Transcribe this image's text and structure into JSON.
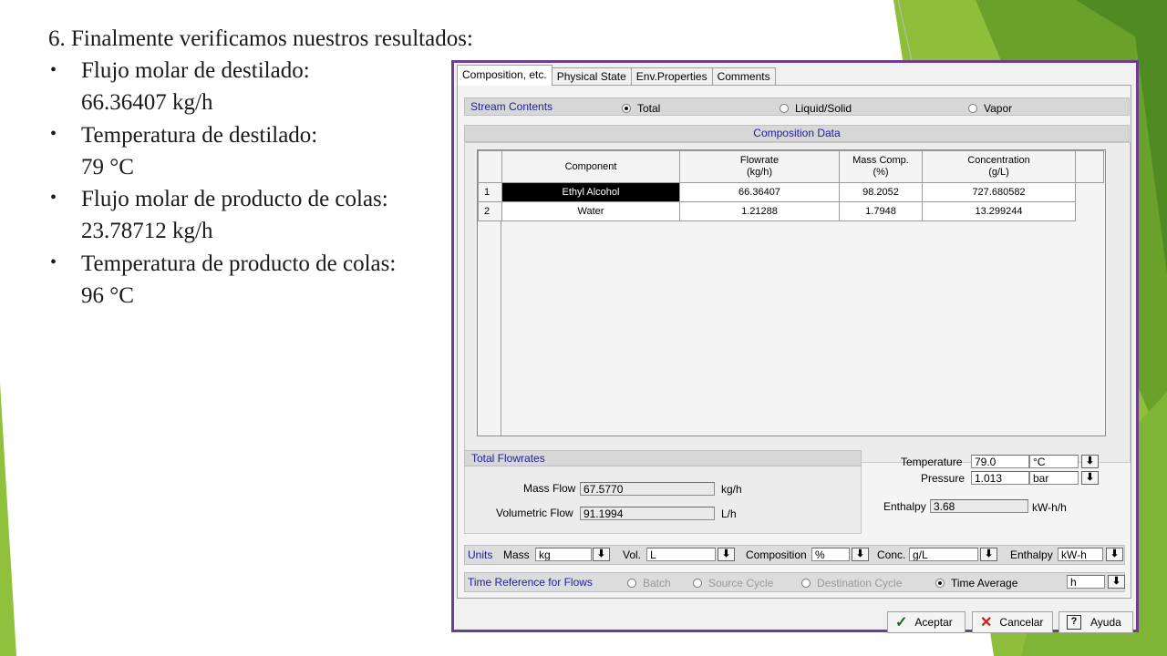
{
  "slide": {
    "heading": "6. Finalmente verificamos nuestros resultados:",
    "bullet_icon": "•",
    "items": [
      {
        "label": "Flujo molar de destilado:",
        "value": "66.36407 kg/h"
      },
      {
        "label": "Temperatura de destilado:",
        "value": "79 °C"
      },
      {
        "label": "Flujo molar de producto de colas:",
        "value": "23.78712 kg/h"
      },
      {
        "label": "Temperatura de producto de colas:",
        "value": "96 °C"
      }
    ],
    "accent_green": "#7db32d",
    "dark_green": "#4d8a24"
  },
  "dialog": {
    "tabs": [
      "Composition, etc.",
      "Physical State",
      "Env.Properties",
      "Comments"
    ],
    "stream_contents": {
      "label": "Stream Contents",
      "options": [
        "Total",
        "Liquid/Solid",
        "Vapor"
      ],
      "selected": "Total"
    },
    "composition_data": {
      "title": "Composition Data",
      "columns": [
        "Component",
        "Flowrate\n(kg/h)",
        "Mass Comp.\n(%)",
        "Concentration\n(g/L)"
      ],
      "columns_line1": [
        "Component",
        "Flowrate",
        "Mass Comp.",
        "Concentration"
      ],
      "columns_line2": [
        "",
        "(kg/h)",
        "(%)",
        "(g/L)"
      ],
      "rows": [
        {
          "num": "1",
          "component": "Ethyl Alcohol",
          "flowrate": "66.36407",
          "mass_comp": "98.2052",
          "concentration": "727.680582"
        },
        {
          "num": "2",
          "component": "Water",
          "flowrate": "1.21288",
          "mass_comp": "1.7948",
          "concentration": "13.299244"
        }
      ]
    },
    "total_flowrates": {
      "title": "Total Flowrates",
      "mass_flow_label": "Mass Flow",
      "mass_flow_value": "67.5770",
      "mass_flow_unit": "kg/h",
      "vol_flow_label": "Volumetric Flow",
      "vol_flow_value": "91.1994",
      "vol_flow_unit": "L/h"
    },
    "conditions": {
      "temperature_label": "Temperature",
      "temperature_value": "79.0",
      "temperature_unit": "°C",
      "pressure_label": "Pressure",
      "pressure_value": "1.013",
      "pressure_unit": "bar",
      "enthalpy_label": "Enthalpy",
      "enthalpy_value": "3.68",
      "enthalpy_unit": "kW-h/h"
    },
    "units": {
      "label": "Units",
      "mass_label": "Mass",
      "mass_value": "kg",
      "vol_label": "Vol.",
      "vol_value": "L",
      "composition_label": "Composition",
      "composition_value": "%",
      "conc_label": "Conc.",
      "conc_value": "g/L",
      "enthalpy_label": "Enthalpy",
      "enthalpy_value": "kW-h"
    },
    "time_reference": {
      "label": "Time Reference for Flows",
      "options": [
        "Batch",
        "Source Cycle",
        "Destination Cycle",
        "Time Average"
      ],
      "selected": "Time Average",
      "unit_value": "h"
    },
    "buttons": {
      "accept": "Aceptar",
      "cancel": "Cancelar",
      "help": "Ayuda"
    },
    "icons": {
      "dropdown": "arrow-down-icon",
      "accept": "check-icon",
      "cancel": "x-icon",
      "help": "help-icon"
    },
    "frame_color": "#6b3f8e"
  }
}
